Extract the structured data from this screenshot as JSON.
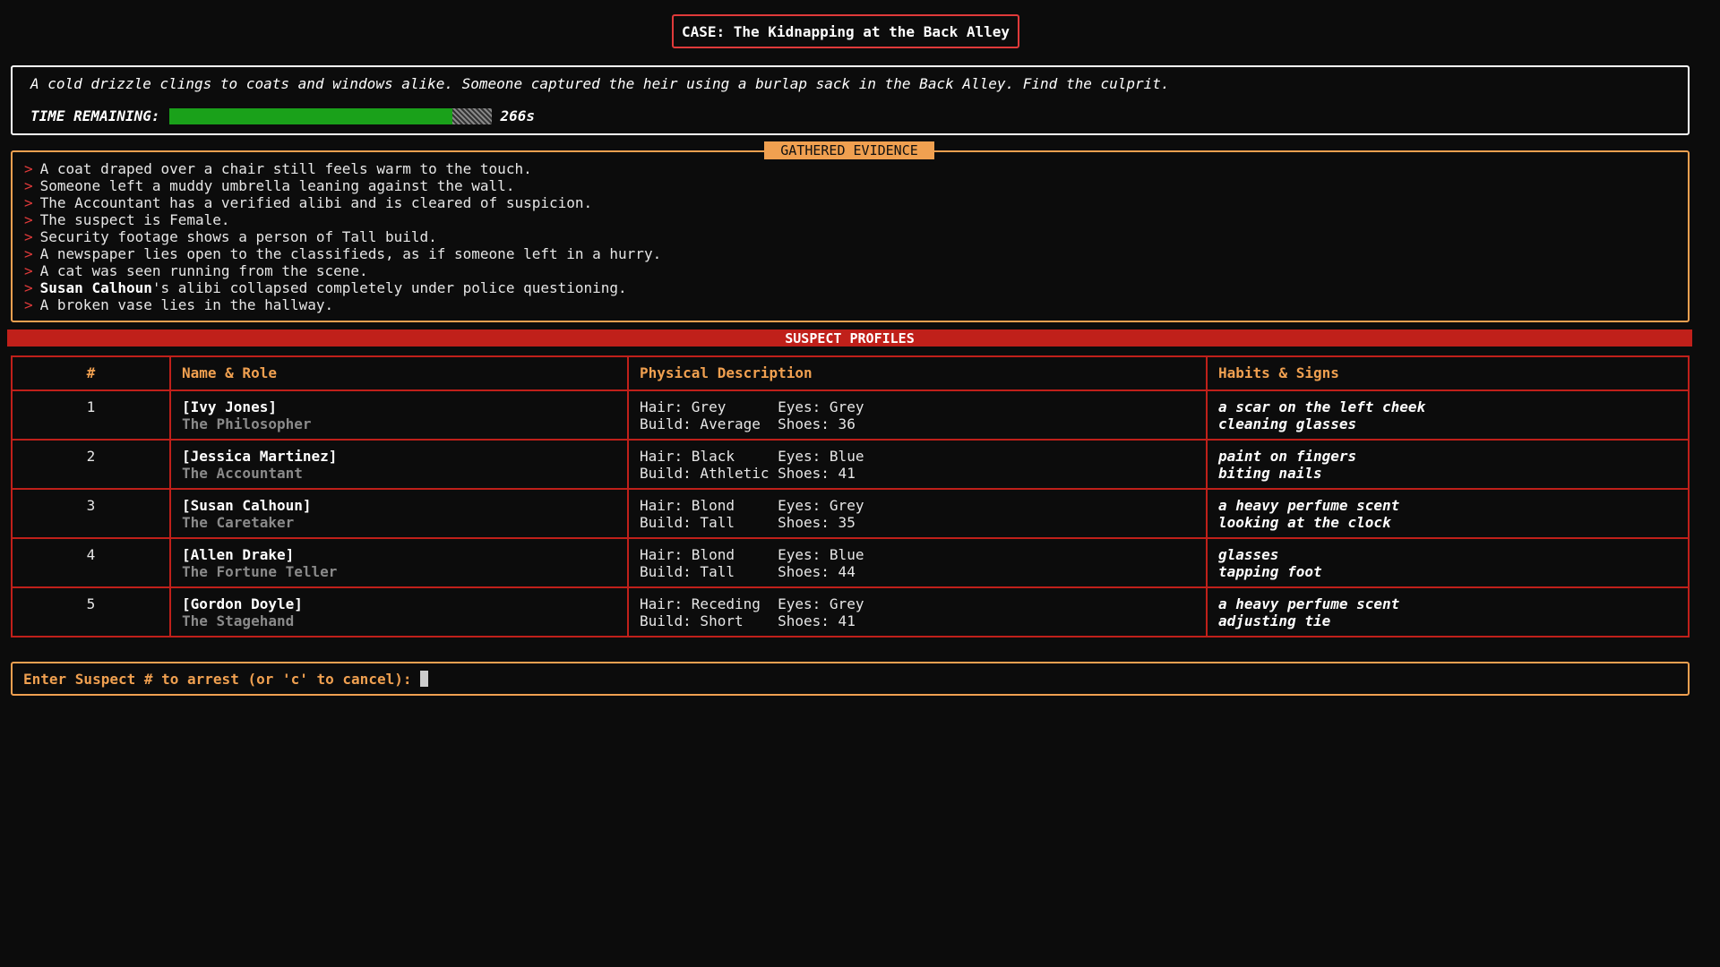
{
  "case_title": "CASE: The Kidnapping at the Back Alley",
  "intro": "A cold drizzle clings to coats and windows alike. Someone captured the heir using a burlap sack in the Back Alley. Find the culprit.",
  "timer": {
    "label": "TIME REMAINING:",
    "value": "266s",
    "fraction_remaining": 0.88,
    "fill_color": "#1aa11a"
  },
  "evidence": {
    "title": "GATHERED EVIDENCE",
    "marker": ">",
    "items": [
      {
        "bold": "",
        "text": "A coat draped over a chair still feels warm to the touch."
      },
      {
        "bold": "",
        "text": "Someone left a muddy umbrella leaning against the wall."
      },
      {
        "bold": "",
        "text": "The Accountant has a verified alibi and is cleared of suspicion."
      },
      {
        "bold": "",
        "text": "The suspect is Female."
      },
      {
        "bold": "",
        "text": "Security footage shows a person of Tall build."
      },
      {
        "bold": "",
        "text": "A newspaper lies open to the classifieds, as if someone left in a hurry."
      },
      {
        "bold": "",
        "text": "A cat was seen running from the scene."
      },
      {
        "bold": "Susan Calhoun",
        "text": "'s alibi collapsed completely under police questioning."
      },
      {
        "bold": "",
        "text": "A broken vase lies in the hallway."
      }
    ]
  },
  "suspects": {
    "title": "SUSPECT PROFILES",
    "columns": [
      "#",
      "Name & Role",
      "Physical Description",
      "Habits & Signs"
    ],
    "rows": [
      {
        "num": "1",
        "name": "[Ivy Jones]",
        "role": "The Philosopher",
        "phys1": "Hair: Grey      Eyes: Grey",
        "phys2": "Build: Average  Shoes: 36",
        "habit1": "a scar on the left cheek",
        "habit2": "cleaning glasses"
      },
      {
        "num": "2",
        "name": "[Jessica Martinez]",
        "role": "The Accountant",
        "phys1": "Hair: Black     Eyes: Blue",
        "phys2": "Build: Athletic Shoes: 41",
        "habit1": "paint on fingers",
        "habit2": "biting nails"
      },
      {
        "num": "3",
        "name": "[Susan Calhoun]",
        "role": "The Caretaker",
        "phys1": "Hair: Blond     Eyes: Grey",
        "phys2": "Build: Tall     Shoes: 35",
        "habit1": "a heavy perfume scent",
        "habit2": "looking at the clock"
      },
      {
        "num": "4",
        "name": "[Allen Drake]",
        "role": "The Fortune Teller",
        "phys1": "Hair: Blond     Eyes: Blue",
        "phys2": "Build: Tall     Shoes: 44",
        "habit1": "glasses",
        "habit2": "tapping foot"
      },
      {
        "num": "5",
        "name": "[Gordon Doyle]",
        "role": "The Stagehand",
        "phys1": "Hair: Receding  Eyes: Grey",
        "phys2": "Build: Short    Shoes: 41",
        "habit1": "a heavy perfume scent",
        "habit2": "adjusting tie"
      }
    ]
  },
  "prompt": {
    "text": "Enter Suspect # to arrest (or 'c' to cancel):",
    "value": ""
  },
  "colors": {
    "accent_orange": "#f0a050",
    "accent_red": "#c0201a",
    "background": "#0c0c0c"
  }
}
